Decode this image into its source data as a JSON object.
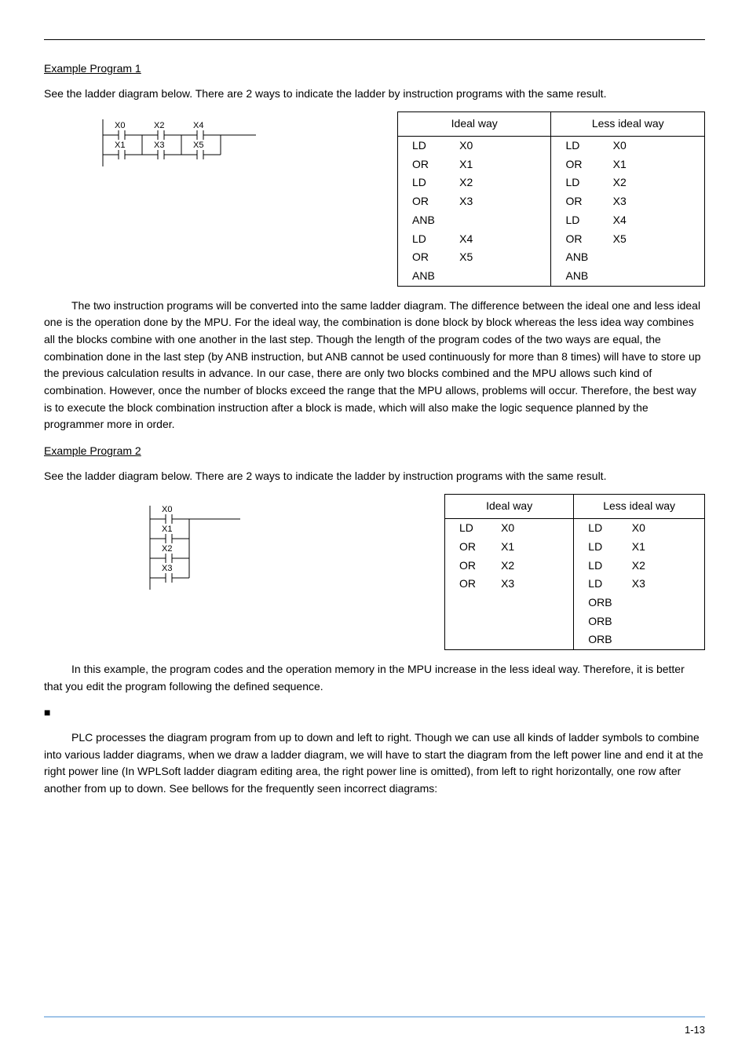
{
  "section1_title": "Example Program 1",
  "section1_intro": "See the ladder diagram below. There are 2 ways to indicate the ladder by instruction programs with the same result.",
  "ladder1": {
    "labels": [
      "X0",
      "X2",
      "X4",
      "X1",
      "X3",
      "X5"
    ]
  },
  "table_headers": {
    "ideal": "Ideal way",
    "less": "Less ideal way"
  },
  "table1_ideal": [
    [
      "LD",
      "X0"
    ],
    [
      "OR",
      "X1"
    ],
    [
      "LD",
      "X2"
    ],
    [
      "OR",
      "X3"
    ],
    [
      "ANB",
      ""
    ],
    [
      "LD",
      "X4"
    ],
    [
      "OR",
      "X5"
    ],
    [
      "ANB",
      ""
    ]
  ],
  "table1_less": [
    [
      "LD",
      "X0"
    ],
    [
      "OR",
      "X1"
    ],
    [
      "LD",
      "X2"
    ],
    [
      "OR",
      "X3"
    ],
    [
      "LD",
      "X4"
    ],
    [
      "OR",
      "X5"
    ],
    [
      "ANB",
      ""
    ],
    [
      "ANB",
      ""
    ]
  ],
  "para1": "The two instruction programs will be converted into the same ladder diagram. The difference between the ideal one and less ideal one is the operation done by the MPU. For the ideal way, the combination is done block by block whereas the less idea way combines all the blocks combine with one another in the last step. Though the length of the program codes of the two ways are equal, the combination done in the last step (by ANB instruction, but ANB cannot be used continuously for more than 8 times) will have to store up the previous calculation results in advance. In our case, there are only two blocks combined and the MPU allows such kind of combination. However, once the number of blocks exceed the range that the MPU allows, problems will occur. Therefore, the best way is to execute the block combination instruction after a block is made, which will also make the logic sequence planned by the programmer more in order.",
  "section2_title": "Example Program 2",
  "section2_intro": "See the ladder diagram below. There are 2 ways to indicate the ladder by instruction programs with the same result.",
  "ladder2": {
    "labels": [
      "X0",
      "X1",
      "X2",
      "X3"
    ]
  },
  "table2_ideal": [
    [
      "LD",
      "X0"
    ],
    [
      "OR",
      "X1"
    ],
    [
      "OR",
      "X2"
    ],
    [
      "OR",
      "X3"
    ]
  ],
  "table2_less": [
    [
      "LD",
      "X0"
    ],
    [
      "LD",
      "X1"
    ],
    [
      "LD",
      "X2"
    ],
    [
      "LD",
      "X3"
    ],
    [
      "ORB",
      ""
    ],
    [
      "ORB",
      ""
    ],
    [
      "ORB",
      ""
    ]
  ],
  "para2": "In this example, the program codes and the operation memory in the MPU increase in the less ideal way. Therefore, it is better that you edit the program following the defined sequence.",
  "bullet": "■",
  "para3": "PLC processes the diagram program from up to down and left to right. Though we can use all kinds of ladder symbols to combine into various ladder diagrams, when we draw a ladder diagram, we will have to start the diagram from the left power line and end it at the right power line (In WPLSoft ladder diagram editing area, the right power line is omitted), from left to right horizontally, one row after another from up to down. See bellows for the frequently seen incorrect diagrams:",
  "page_number": "1-13",
  "chart_data": [
    {
      "type": "table",
      "title": "Example Program 1 instruction lists",
      "series": [
        {
          "name": "Ideal way",
          "rows": [
            [
              "LD",
              "X0"
            ],
            [
              "OR",
              "X1"
            ],
            [
              "LD",
              "X2"
            ],
            [
              "OR",
              "X3"
            ],
            [
              "ANB",
              ""
            ],
            [
              "LD",
              "X4"
            ],
            [
              "OR",
              "X5"
            ],
            [
              "ANB",
              ""
            ]
          ]
        },
        {
          "name": "Less ideal way",
          "rows": [
            [
              "LD",
              "X0"
            ],
            [
              "OR",
              "X1"
            ],
            [
              "LD",
              "X2"
            ],
            [
              "OR",
              "X3"
            ],
            [
              "LD",
              "X4"
            ],
            [
              "OR",
              "X5"
            ],
            [
              "ANB",
              ""
            ],
            [
              "ANB",
              ""
            ]
          ]
        }
      ]
    },
    {
      "type": "table",
      "title": "Example Program 2 instruction lists",
      "series": [
        {
          "name": "Ideal way",
          "rows": [
            [
              "LD",
              "X0"
            ],
            [
              "OR",
              "X1"
            ],
            [
              "OR",
              "X2"
            ],
            [
              "OR",
              "X3"
            ]
          ]
        },
        {
          "name": "Less ideal way",
          "rows": [
            [
              "LD",
              "X0"
            ],
            [
              "LD",
              "X1"
            ],
            [
              "LD",
              "X2"
            ],
            [
              "LD",
              "X3"
            ],
            [
              "ORB",
              ""
            ],
            [
              "ORB",
              ""
            ],
            [
              "ORB",
              ""
            ]
          ]
        }
      ]
    }
  ]
}
